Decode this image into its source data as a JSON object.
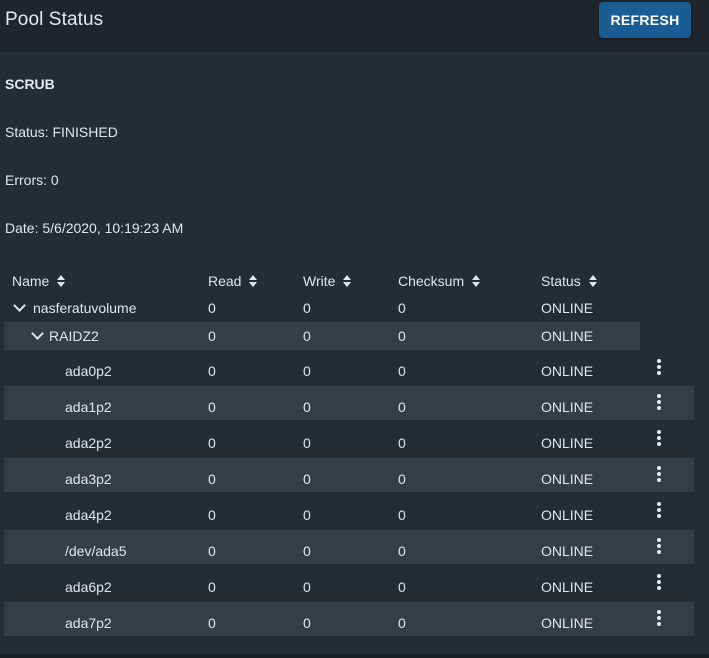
{
  "page": {
    "title": "Pool Status",
    "refresh_label": "REFRESH"
  },
  "scrub": {
    "heading": "SCRUB",
    "status": "Status: FINISHED",
    "errors": "Errors: 0",
    "date": "Date: 5/6/2020, 10:19:23 AM"
  },
  "table": {
    "columns": [
      "Name",
      "Read",
      "Write",
      "Checksum",
      "Status"
    ],
    "pool": {
      "name": "nasferatuvolume",
      "read": "0",
      "write": "0",
      "checksum": "0",
      "status": "ONLINE"
    },
    "vdev": {
      "name": "RAIDZ2",
      "read": "0",
      "write": "0",
      "checksum": "0",
      "status": "ONLINE"
    },
    "disks": [
      {
        "name": "ada0p2",
        "read": "0",
        "write": "0",
        "checksum": "0",
        "status": "ONLINE"
      },
      {
        "name": "ada1p2",
        "read": "0",
        "write": "0",
        "checksum": "0",
        "status": "ONLINE"
      },
      {
        "name": "ada2p2",
        "read": "0",
        "write": "0",
        "checksum": "0",
        "status": "ONLINE"
      },
      {
        "name": "ada3p2",
        "read": "0",
        "write": "0",
        "checksum": "0",
        "status": "ONLINE"
      },
      {
        "name": "ada4p2",
        "read": "0",
        "write": "0",
        "checksum": "0",
        "status": "ONLINE"
      },
      {
        "name": "/dev/ada5",
        "read": "0",
        "write": "0",
        "checksum": "0",
        "status": "ONLINE"
      },
      {
        "name": "ada6p2",
        "read": "0",
        "write": "0",
        "checksum": "0",
        "status": "ONLINE"
      },
      {
        "name": "ada7p2",
        "read": "0",
        "write": "0",
        "checksum": "0",
        "status": "ONLINE"
      }
    ]
  },
  "colors": {
    "background": "#252c32",
    "header_bar": "#1f252b",
    "row_stripe": "#353d45",
    "accent": "#1a5d94",
    "text": "#e2e6ea"
  },
  "icons": {
    "sort": "sort-icon",
    "expand": "chevron-down-icon",
    "row_menu": "more-vertical-icon"
  }
}
